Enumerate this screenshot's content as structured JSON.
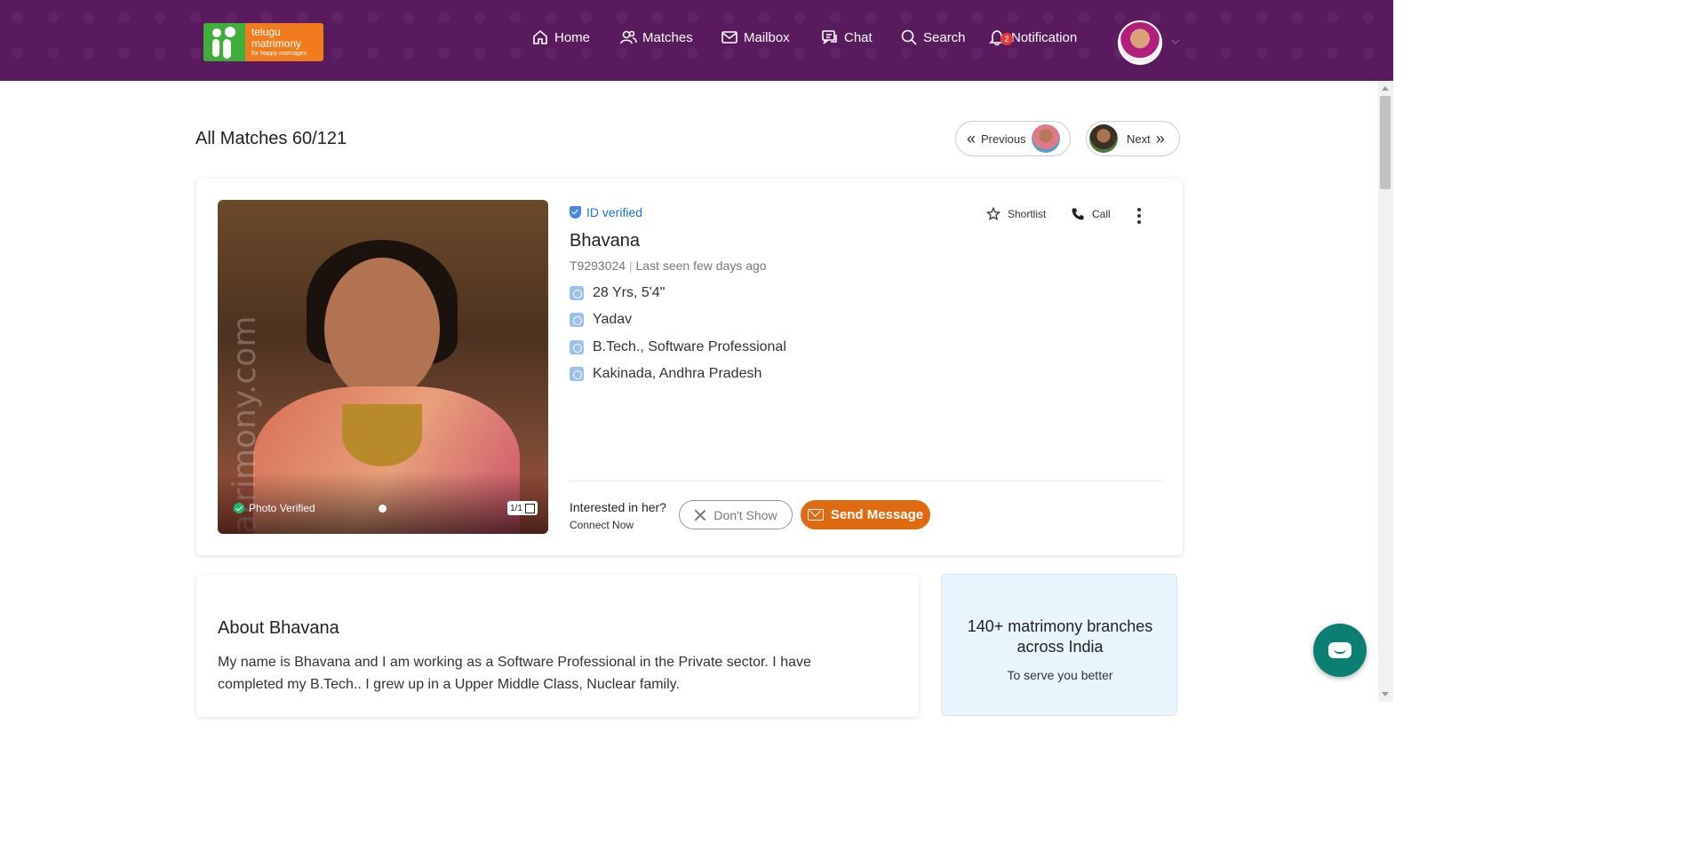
{
  "logo": {
    "line1": "telugu",
    "line2": "matrimony",
    "tagline": "for happy marriages"
  },
  "nav": {
    "home": "Home",
    "matches": "Matches",
    "mailbox": "Mailbox",
    "chat": "Chat",
    "search": "Search",
    "notification": "Notification",
    "notification_count": "2"
  },
  "page": {
    "title": "All Matches 60/121",
    "previous": "Previous",
    "next": "Next"
  },
  "profile": {
    "id_verified": "ID verified",
    "name": "Bhavana",
    "profile_id": "T9293024",
    "last_seen": "Last seen few days ago",
    "age_height": "28 Yrs, 5'4\"",
    "caste": "Yadav",
    "education_job": "B.Tech., Software Professional",
    "location": "Kakinada, Andhra Pradesh",
    "photo_verified": "Photo Verified",
    "photo_count": "1/1",
    "watermark": "atrimony.com",
    "shortlist": "Shortlist",
    "call": "Call",
    "interested": "Interested in her?",
    "connect_now": "Connect Now",
    "dont_show": "Don't Show",
    "send_message": "Send Message"
  },
  "about": {
    "title": "About Bhavana",
    "text": "My name is Bhavana and I am working as a Software Professional in the Private sector. I have completed my B.Tech.. I grew up in a Upper Middle Class, Nuclear family."
  },
  "branches": {
    "headline": "140+ matrimony branches across India",
    "subtext": "To serve you better"
  },
  "colors": {
    "header_bg": "#5a1a5e",
    "accent_orange": "#e06a12",
    "link_blue": "#1d6fd8",
    "chat_fab": "#0b7f72"
  }
}
